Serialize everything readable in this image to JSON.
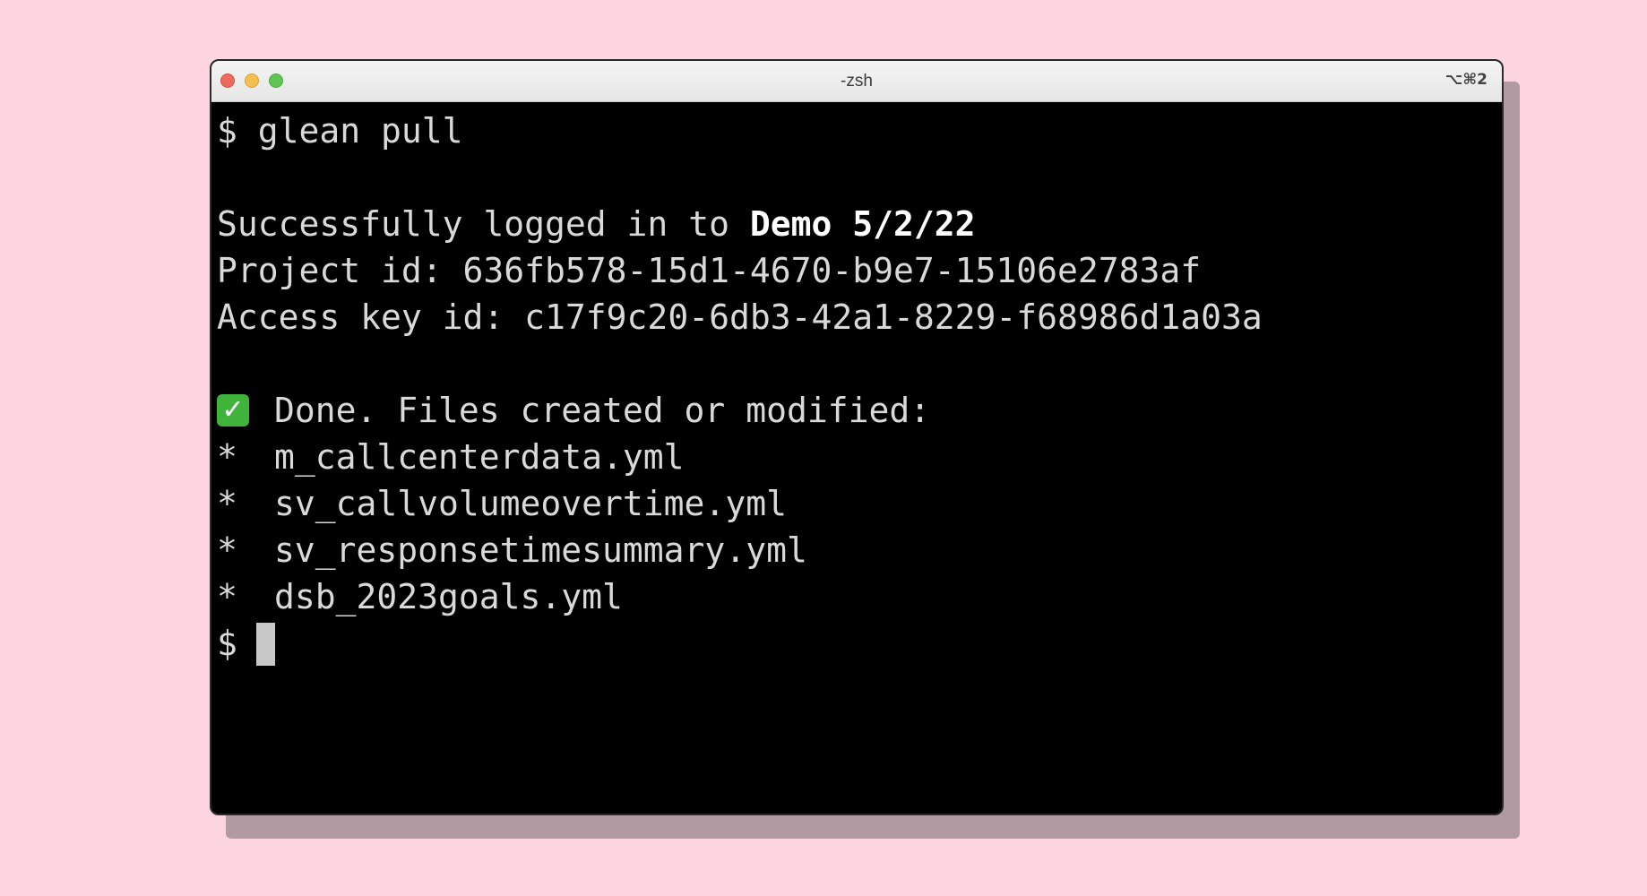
{
  "window": {
    "title": "-zsh",
    "shortcut": "⌥⌘2"
  },
  "terminal": {
    "prompt_symbol": "$",
    "command": "glean pull",
    "login_prefix": "Successfully logged in to ",
    "login_project": "Demo 5/2/22",
    "project_id_line": "Project id: 636fb578-15d1-4670-b9e7-15106e2783af",
    "access_key_line": "Access key id: c17f9c20-6db3-42a1-8229-f68986d1a03a",
    "done_icon": "check-mark-icon",
    "done_text": "Done. Files created or modified:",
    "bullet": "*",
    "files": [
      "m_callcenterdata.yml",
      "sv_callvolumeovertime.yml",
      "sv_responsetimesummary.yml",
      "dsb_2023goals.yml"
    ]
  },
  "colors": {
    "background": "#fcd5e1",
    "terminal_bg": "#000000",
    "terminal_text": "#d9d9d9",
    "check_green": "#3fb33a"
  }
}
